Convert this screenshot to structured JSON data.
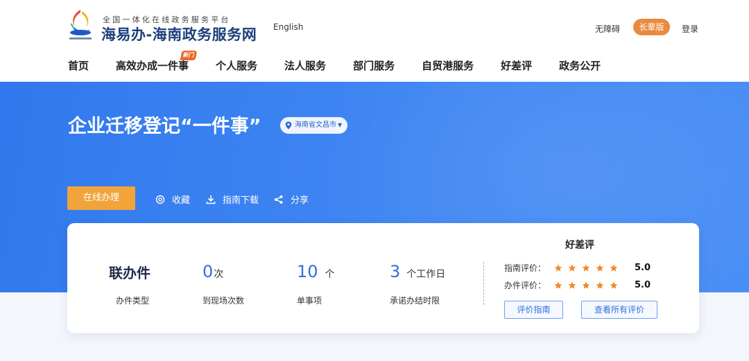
{
  "header": {
    "site_subtitle": "全国一体化在线政务服务平台",
    "site_title": "海易办-海南政务服务网",
    "logo_small_text": "海南政务服务网",
    "lang_link": "English",
    "accessible_link": "无障碍",
    "elder_mode_button": "长辈版",
    "login_link": "登录"
  },
  "nav": {
    "items": [
      {
        "label": "首页"
      },
      {
        "label": "高效办成一件事",
        "badge": "新门"
      },
      {
        "label": "个人服务"
      },
      {
        "label": "法人服务"
      },
      {
        "label": "部门服务"
      },
      {
        "label": "自贸港服务"
      },
      {
        "label": "好差评"
      },
      {
        "label": "政务公开"
      }
    ]
  },
  "banner": {
    "title": "企业迁移登记“一件事”",
    "region": "海南省文昌市",
    "online_button": "在线办理",
    "actions": {
      "favorite": "收藏",
      "download": "指南下载",
      "share": "分享"
    }
  },
  "summary": {
    "type_value": "联办件",
    "type_label": "办件类型",
    "visits_value": "0",
    "visits_unit": "次",
    "visits_label": "到现场次数",
    "items_value": "10",
    "items_unit": "个",
    "items_label": "单事项",
    "time_value": "3",
    "time_unit": "个工作日",
    "time_label": "承诺办结时限"
  },
  "rating": {
    "title": "好差评",
    "guide_label": "指南评价：",
    "guide_stars": 5,
    "guide_score": "5.0",
    "process_label": "办件评价：",
    "process_stars": 5,
    "process_score": "5.0",
    "guide_button": "评价指南",
    "all_button": "查看所有评价"
  },
  "colors": {
    "brand_blue": "#3178ee",
    "accent_orange": "#f2a33a",
    "elder_orange": "#e98b3e",
    "star_orange": "#f08a2c",
    "title_navy": "#1d3f7a"
  }
}
